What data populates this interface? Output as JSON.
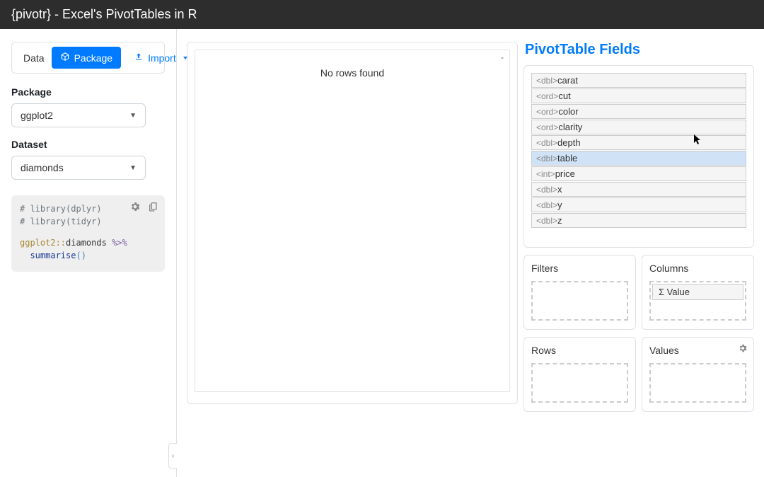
{
  "header": {
    "title": "{pivotr} - Excel's PivotTables in R"
  },
  "sidebar": {
    "tabs": {
      "data": "Data",
      "package": "Package",
      "import": "Import"
    },
    "package_label": "Package",
    "package_value": "ggplot2",
    "dataset_label": "Dataset",
    "dataset_value": "diamonds",
    "code": {
      "l1": "# library(dplyr)",
      "l2": "# library(tidyr)",
      "l3_ns": "ggplot2::",
      "l3_obj": "diamonds ",
      "l3_op": "%>%",
      "l4_indent": "  ",
      "l4_fn": "summarise",
      "l4_paren": "()"
    }
  },
  "table": {
    "header_corner": "-",
    "no_rows": "No rows found"
  },
  "pivot": {
    "title": "PivotTable Fields",
    "fields": [
      {
        "type": "<dbl>",
        "name": "carat",
        "highlight": false
      },
      {
        "type": "<ord>",
        "name": "cut",
        "highlight": false
      },
      {
        "type": "<ord>",
        "name": "color",
        "highlight": false
      },
      {
        "type": "<ord>",
        "name": "clarity",
        "highlight": false
      },
      {
        "type": "<dbl>",
        "name": "depth",
        "highlight": false
      },
      {
        "type": "<dbl>",
        "name": "table",
        "highlight": true
      },
      {
        "type": "<int>",
        "name": "price",
        "highlight": false
      },
      {
        "type": "<dbl>",
        "name": "x",
        "highlight": false
      },
      {
        "type": "<dbl>",
        "name": "y",
        "highlight": false
      },
      {
        "type": "<dbl>",
        "name": "z",
        "highlight": false
      }
    ],
    "zones": {
      "filters": "Filters",
      "columns": "Columns",
      "rows": "Rows",
      "values": "Values",
      "sigma_value": "Σ Value"
    }
  }
}
